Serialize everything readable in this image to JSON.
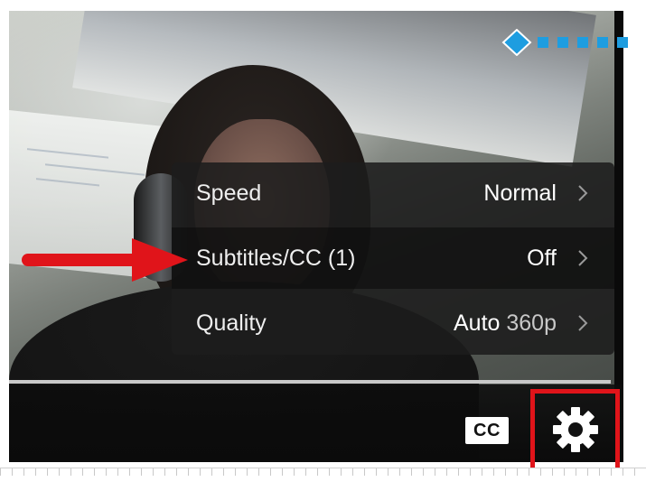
{
  "menu": {
    "rows": [
      {
        "label": "Speed",
        "value": "Normal",
        "value_suffix": ""
      },
      {
        "label": "Subtitles/CC (1)",
        "value": "Off",
        "value_suffix": ""
      },
      {
        "label": "Quality",
        "value": "Auto",
        "value_suffix": "360p"
      }
    ],
    "highlighted_row": "Subtitles/CC (1)"
  },
  "controls": {
    "cc_label": "CC",
    "settings_icon": "gear-icon"
  },
  "annotations": {
    "arrow_color": "#e0141a",
    "highlight_box_color": "#e0141a"
  },
  "decoration": {
    "diamond_color": "#1e9de0"
  }
}
